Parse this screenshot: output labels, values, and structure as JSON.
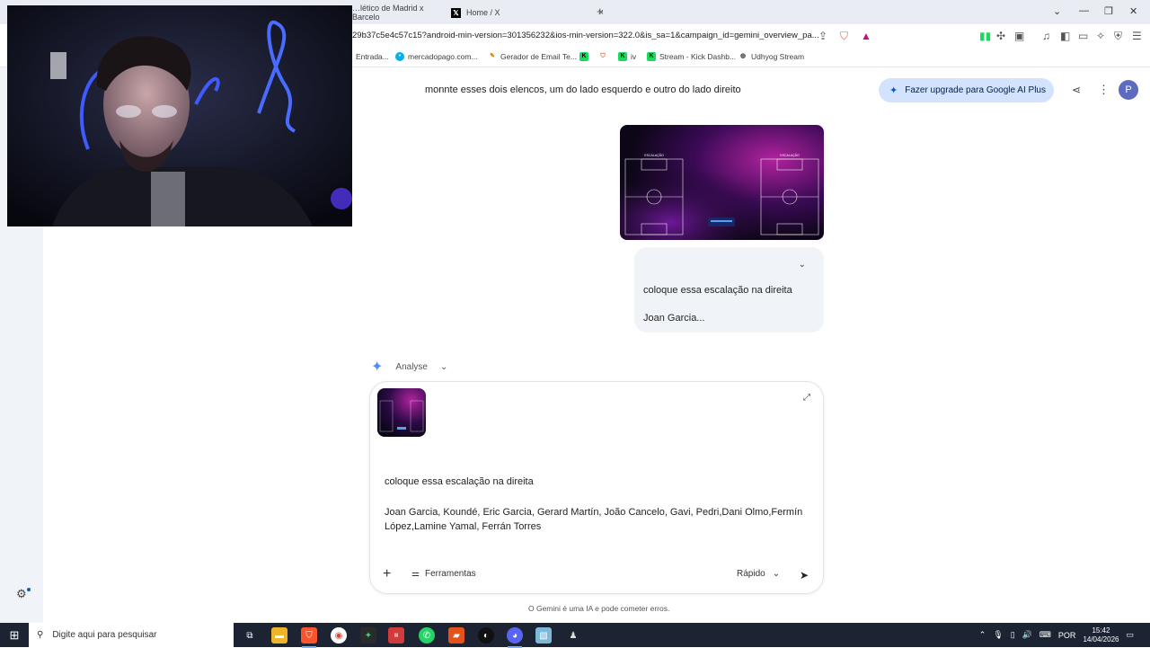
{
  "browser": {
    "tabs": [
      {
        "title": "…lético de Madrid x Barcelo"
      },
      {
        "title": "Home / X"
      }
    ],
    "new_tab": "+",
    "url": "29b37c5e4c57c15?android-min-version=301356232&ios-min-version=322.0&is_sa=1&campaign_id=gemini_overview_pa...",
    "bookmarks": [
      "Entrada...",
      "mercadopago.com...",
      "Gerador de Email Te...",
      "iv",
      "Stream - Kick Dashb...",
      "Udhyog Stream"
    ]
  },
  "gemini": {
    "previous_prompt": "monnte esses dois elencos, um do lado esquerdo e outro do lado direito",
    "upgrade_label": "Fazer upgrade para Google AI Plus",
    "avatar_letter": "P",
    "image_labels": {
      "left": "ESCALAÇÃO",
      "right": "ESCALAÇÃO"
    },
    "bubble": {
      "line1": "coloque essa escalação na direita",
      "line2": "Joan Garcia..."
    },
    "status_label": "Analyse",
    "composer": {
      "line1": "coloque essa escalação na direita",
      "line2": "Joan Garcia, Koundé, Eric Garcia, Gerard Martín, João Cancelo, Gavi, Pedri,Dani Olmo,Fermín López,Lamine Yamal, Ferrán Torres",
      "tools_label": "Ferramentas",
      "mode_label": "Rápido"
    },
    "disclaimer": "O Gemini é uma IA e pode cometer erros."
  },
  "taskbar": {
    "search_placeholder": "Digite aqui para pesquisar",
    "language": "POR",
    "time": "15:42",
    "date": "14/04/2026"
  }
}
